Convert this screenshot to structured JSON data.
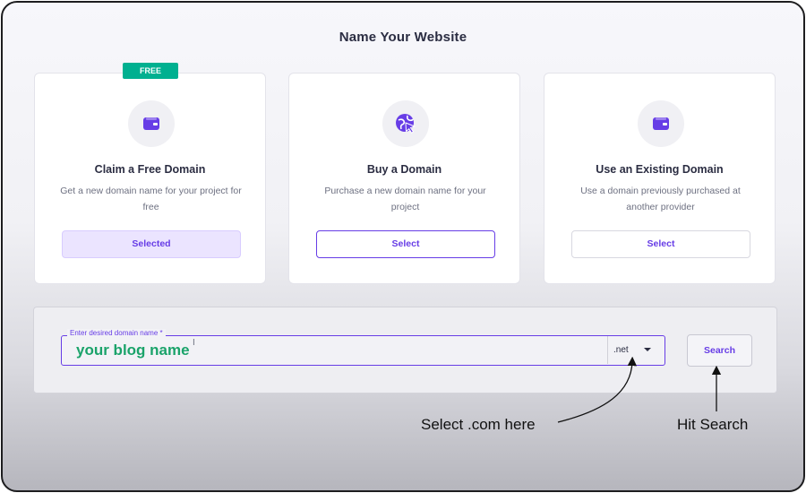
{
  "page": {
    "title": "Name Your Website"
  },
  "options": [
    {
      "title": "Claim a Free Domain",
      "description": "Get a new domain name for your project for free",
      "button_label": "Selected",
      "badge": "FREE",
      "icon": "wallet-icon",
      "state": "selected"
    },
    {
      "title": "Buy a Domain",
      "description": "Purchase a new domain name for your project",
      "button_label": "Select",
      "icon": "globe-cursor-icon",
      "state": "default"
    },
    {
      "title": "Use an Existing Domain",
      "description": "Use a domain previously purchased at another provider",
      "button_label": "Select",
      "icon": "wallet-icon",
      "state": "default"
    }
  ],
  "search": {
    "field_label": "Enter desired domain name *",
    "field_value": "your blog name",
    "tld_value": ".net",
    "button_label": "Search"
  },
  "annotations": {
    "select_tld": "Select .com here",
    "hit_search": "Hit Search"
  },
  "colors": {
    "accent": "#673de6",
    "free_badge": "#00b090",
    "typed_text": "#1aa36a",
    "selected_bg": "#ebe4ff"
  }
}
